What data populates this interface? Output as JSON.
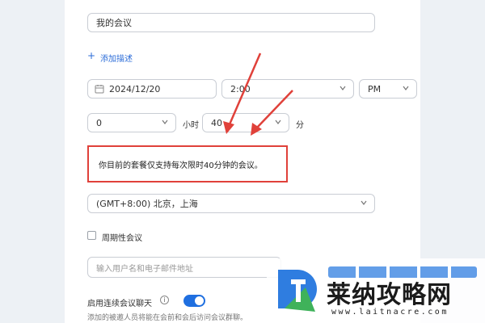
{
  "form": {
    "topic_value": "我的会议",
    "add_description_label": "添加描述",
    "date_value": "2024/12/20",
    "time_value": "2:00",
    "ampm_value": "PM",
    "duration_hours_value": "0",
    "hours_unit": "小时",
    "duration_minutes_value": "40",
    "minutes_unit": "分",
    "plan_warning": "你目前的套餐仅支持每次限时40分钟的会议。",
    "timezone_value": "(GMT+8:00) 北京，上海",
    "recurring_label": "周期性会议",
    "invitee_placeholder": "输入用户名和电子邮件地址",
    "continuous_chat_label": "启用连续会议聊天",
    "continuous_chat_enabled": true,
    "continuous_chat_hint": "添加的被邀人员将能在会前和会后访问会议群聊。"
  },
  "icons": {
    "calendar": "calendar-icon",
    "add": "plus-icon",
    "info": "info-icon",
    "dropdown": "chevron-down-icon"
  },
  "annotations": {
    "arrow_color": "#e0413a"
  },
  "watermark": {
    "site_name": "莱纳攻略网",
    "url": "www.laitnacre.com"
  },
  "colors": {
    "accent": "#1f6fe0",
    "link": "#2b6cd8",
    "warning_border": "#e0413a"
  }
}
